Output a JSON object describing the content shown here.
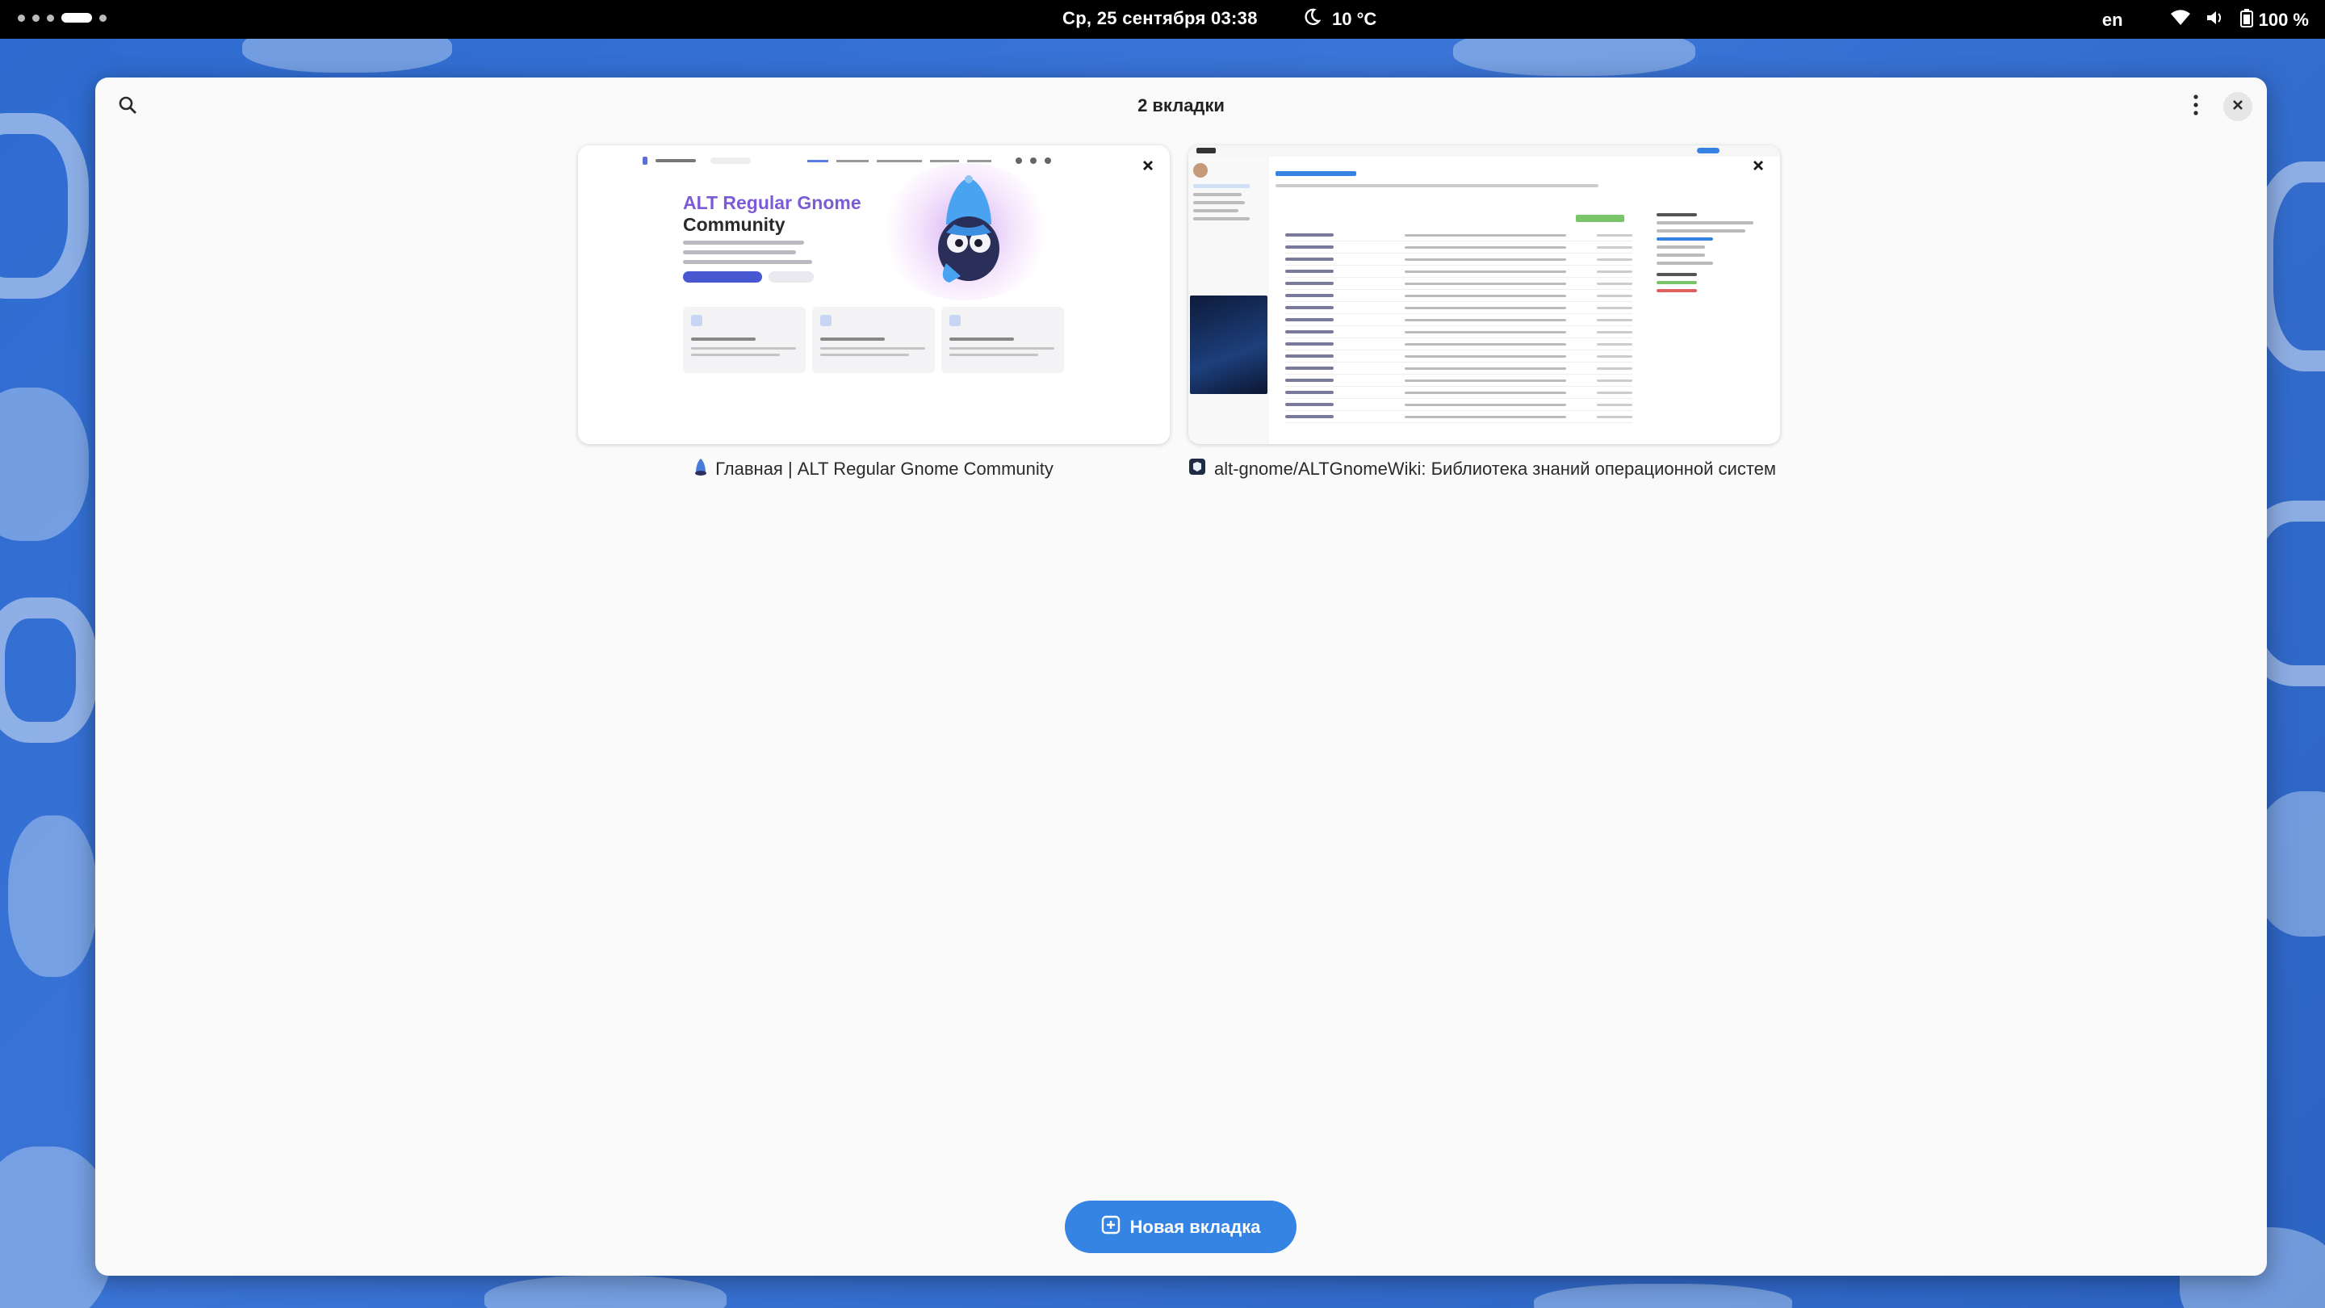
{
  "topbar": {
    "datetime": "Ср, 25 сентября  03:38",
    "weather_icon": "moon-icon",
    "temperature": "10 °C",
    "language": "en",
    "battery": "100 %"
  },
  "overview": {
    "title": "2 вкладки",
    "new_tab_label": "Новая вкладка"
  },
  "tabs": [
    {
      "title": "Главная | ALT Regular Gnome Community",
      "icon": "alt-gnome-favicon",
      "preview": {
        "heading_line1": "ALT Regular Gnome",
        "heading_line2": "Community"
      }
    },
    {
      "title": "alt-gnome/ALTGnomeWiki: Библиотека знаний операционной систем",
      "icon": "gitflic-favicon"
    }
  ],
  "colors": {
    "accent": "#3584e4",
    "topbar": "#000000",
    "window_bg": "#fafafa",
    "wallpaper": "#2f68c6"
  }
}
